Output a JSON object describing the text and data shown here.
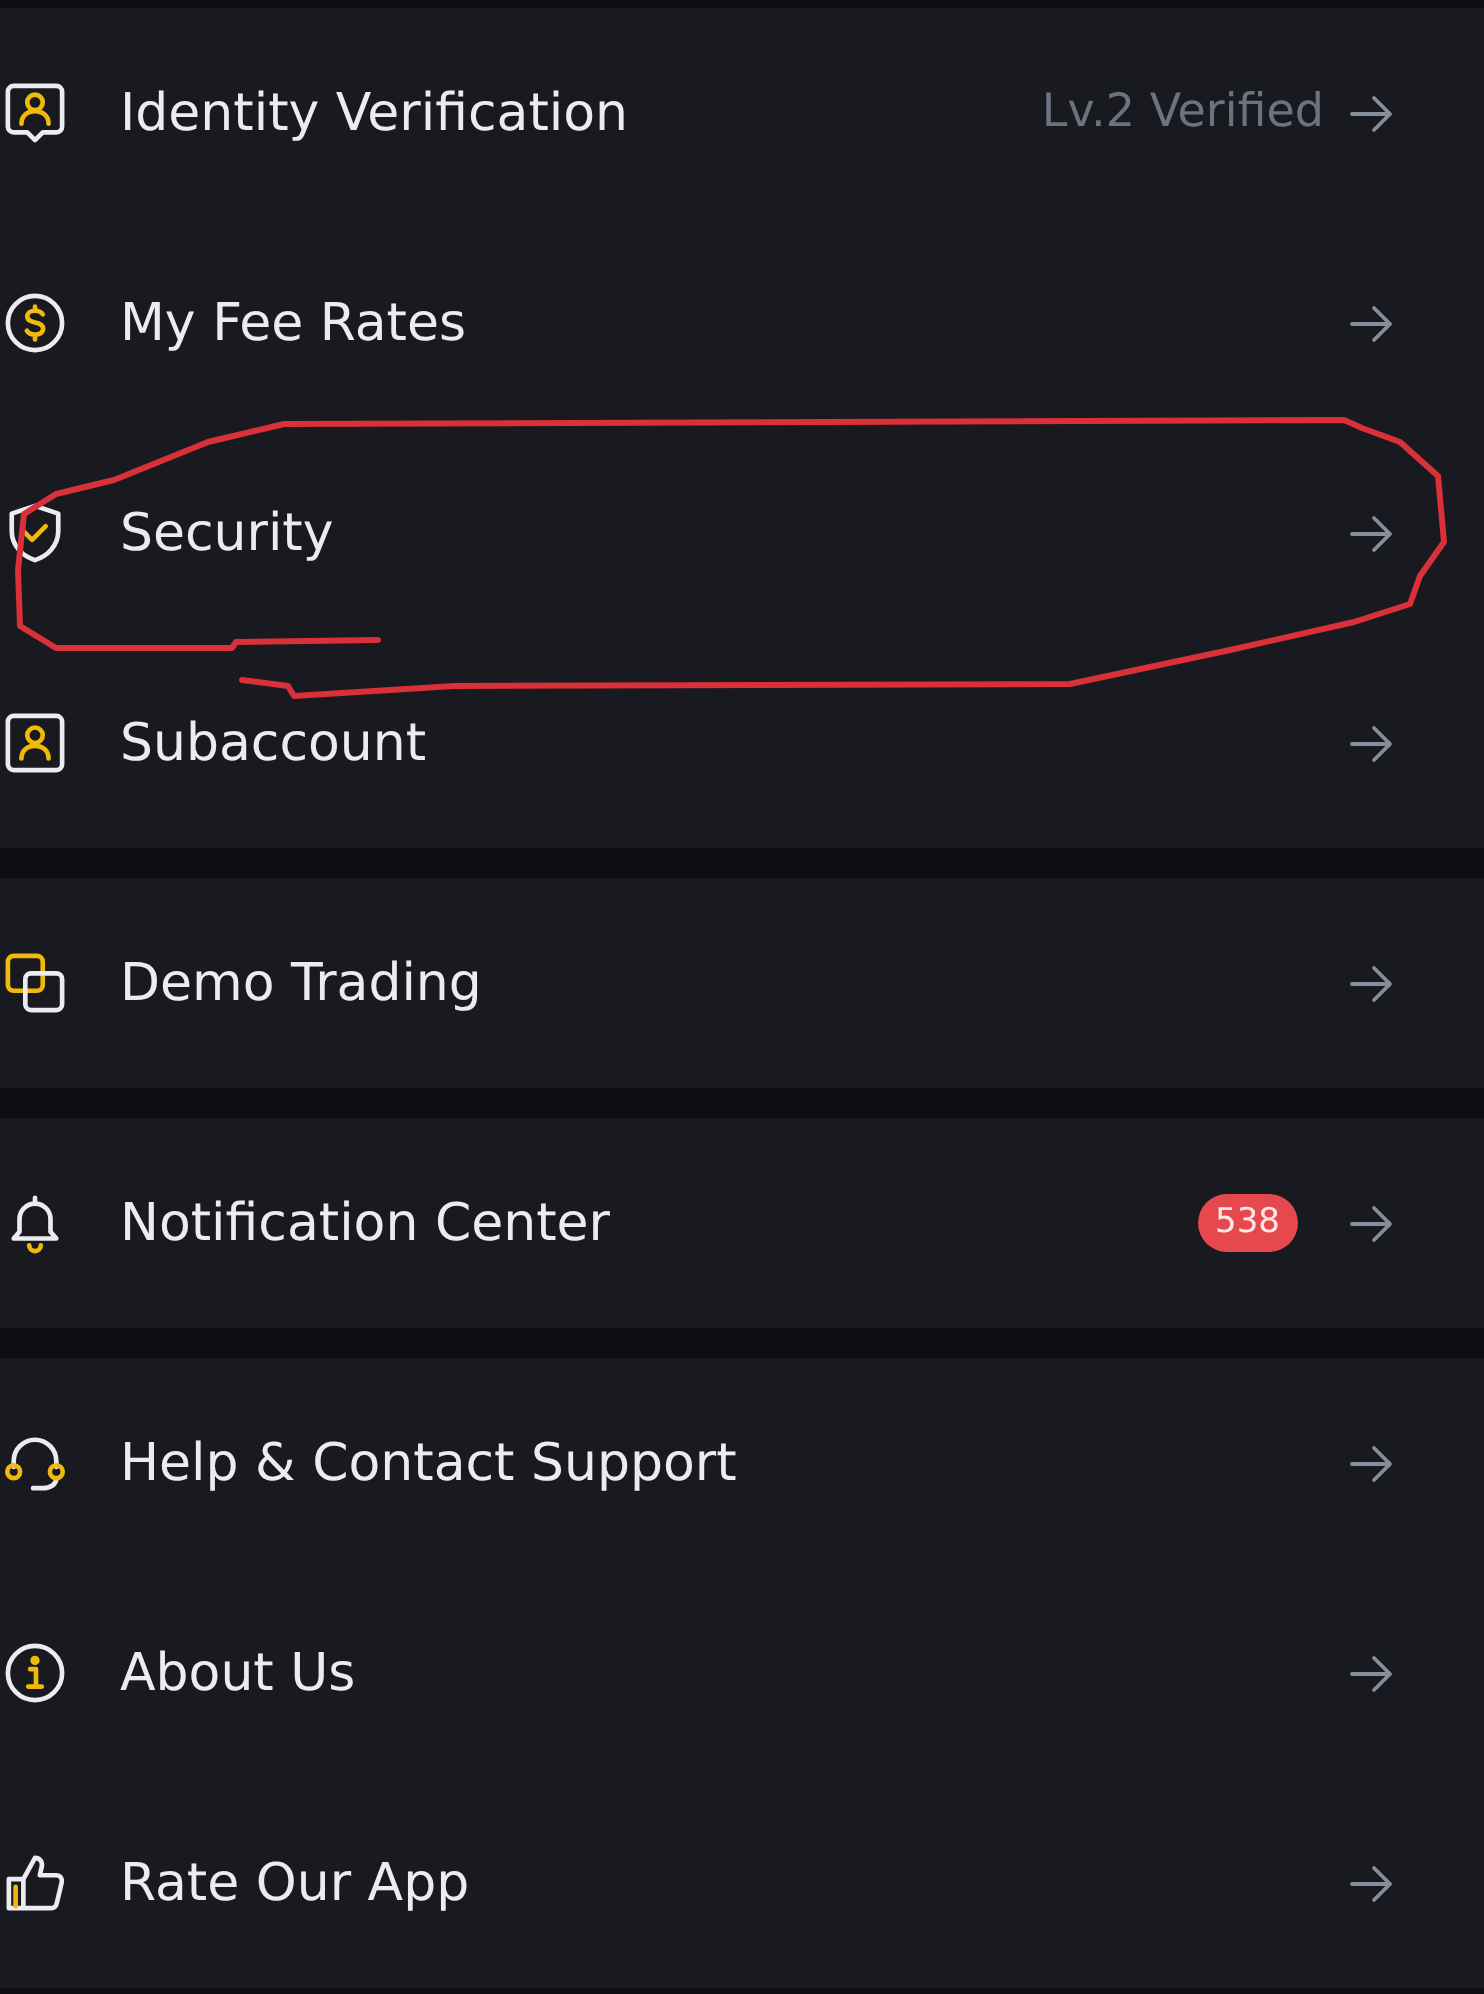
{
  "groups": [
    {
      "items": [
        {
          "label": "Identity Verification",
          "status": "Lv.2 Verified",
          "circled": false
        },
        {
          "label": "My Fee Rates",
          "circled": false
        },
        {
          "label": "Security",
          "circled": true
        },
        {
          "label": "Subaccount",
          "circled": false
        }
      ]
    },
    {
      "items": [
        {
          "label": "Demo Trading",
          "circled": false
        }
      ]
    },
    {
      "items": [
        {
          "label": "Notification Center",
          "badge": "538",
          "circled": false
        }
      ]
    },
    {
      "items": [
        {
          "label": "Help & Contact Support",
          "circled": false
        },
        {
          "label": "About Us",
          "circled": false
        },
        {
          "label": "Rate Our App",
          "circled": false
        }
      ]
    }
  ]
}
